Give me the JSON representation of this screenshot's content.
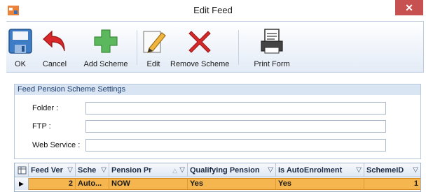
{
  "window": {
    "title": "Edit Feed",
    "close_glyph": "✕"
  },
  "toolbar": {
    "buttons": [
      {
        "label": "OK",
        "icon": "save-disk-icon"
      },
      {
        "label": "Cancel",
        "icon": "undo-arrow-icon"
      },
      {
        "label": "Add Scheme",
        "icon": "plus-icon"
      },
      {
        "label": "Edit",
        "icon": "pencil-edit-icon"
      },
      {
        "label": "Remove Scheme",
        "icon": "red-x-icon"
      },
      {
        "label": "Print Form",
        "icon": "printer-form-icon"
      }
    ]
  },
  "settings": {
    "header": "Feed Pension Scheme Settings",
    "fields": [
      {
        "label": "Folder :",
        "value": ""
      },
      {
        "label": "FTP :",
        "value": ""
      },
      {
        "label": "Web Service :",
        "value": ""
      }
    ]
  },
  "grid": {
    "columns": [
      "Feed Ver",
      "Sche",
      "Pension Pr",
      "Qualifying Pension",
      "Is AutoEnrolment",
      "SchemeID"
    ],
    "rows": [
      [
        "2",
        "Auto...",
        "NOW",
        "Yes",
        "Yes",
        "1"
      ]
    ],
    "selected_row_color": "#f5b650"
  },
  "colors": {
    "close_button": "#c75050",
    "ribbon_border": "#b9c9dd",
    "group_header_bg": "#d9e5f3"
  }
}
